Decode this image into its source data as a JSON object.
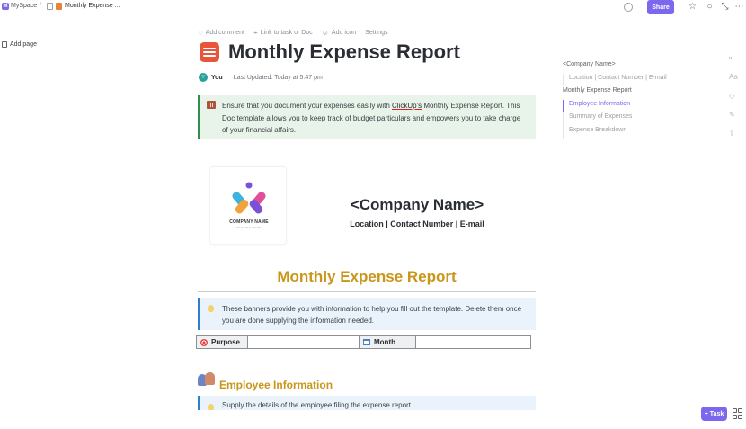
{
  "breadcrumb": {
    "workspace_initial": "M",
    "space": "MySpace",
    "separator": "/",
    "doc": "Monthly Expense ..."
  },
  "header": {
    "share_label": "Share"
  },
  "left_nav": {
    "add_page": "Add page"
  },
  "doc_toolbar": {
    "add_comment": "Add comment",
    "link_task": "Link to task or Doc",
    "add_icon": "Add icon",
    "settings": "Settings"
  },
  "doc": {
    "title": "Monthly Expense Report",
    "author_initials": "Y",
    "author": "You",
    "last_updated": "Last Updated: Today at 5:47 pm",
    "intro_banner": {
      "before_link": "Ensure that you document your expenses easily with ",
      "link": "ClickUp's",
      "after_link": " Monthly Expense Report. This Doc template allows you to keep track of budget particulars and empowers you to take charge of your financial affairs."
    },
    "logo": {
      "name": "COMPANY NAME",
      "tagline": "TAGLINE HERE"
    },
    "company_name": "<Company Name>",
    "company_contact": "Location | Contact Number | E-mail",
    "report_heading": "Monthly Expense Report",
    "info_banner": "These banners provide you with information to help you fill out the template. Delete them once you are done supplying the information needed.",
    "table": {
      "purpose_label": "Purpose",
      "purpose_value": "",
      "month_label": "Month",
      "month_value": ""
    },
    "section_title": "Employee Information",
    "section_banner": "Supply the details of the employee filing the expense report."
  },
  "toc": [
    {
      "label": "<Company Name>",
      "level": 1,
      "active": false
    },
    {
      "label": "Location | Contact Number | E-mail",
      "level": 2,
      "active": false
    },
    {
      "label": "Monthly Expense Report",
      "level": 1,
      "active": false
    },
    {
      "label": "Employee Information",
      "level": 2,
      "active": true
    },
    {
      "label": "Summary of Expenses",
      "level": 2,
      "active": false
    },
    {
      "label": "Expense Breakdown",
      "level": 2,
      "active": false
    }
  ],
  "floating": {
    "task_label": "+ Task"
  },
  "colors": {
    "accent": "#7b68ee",
    "heading_gold": "#c9961a",
    "green_banner": "#e8f3ea",
    "blue_banner": "#eaf3fb"
  }
}
